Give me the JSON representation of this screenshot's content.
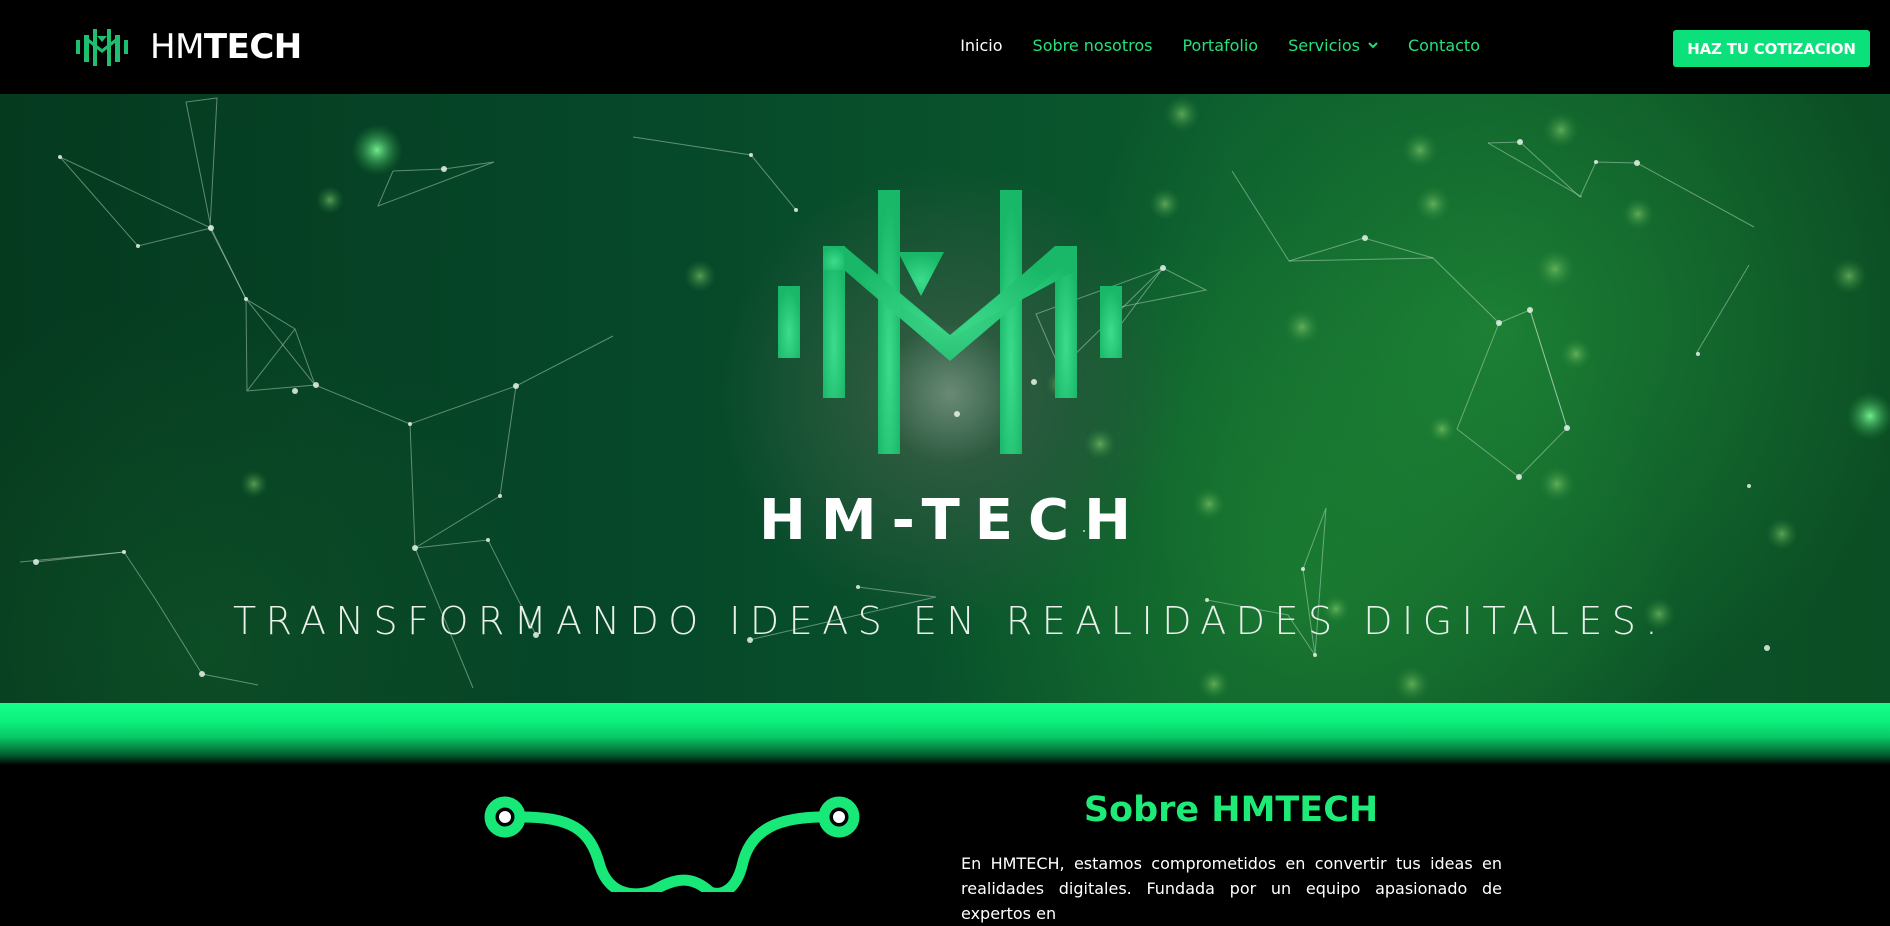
{
  "colors": {
    "accent": "#0be07a",
    "nav_link": "#27e07a",
    "nav_active": "#ffffff",
    "background": "#000000",
    "hero_green": "#0b5a2d",
    "logo_green": "#1ebf6e"
  },
  "header": {
    "brand": {
      "light": "HM",
      "bold": "TECH",
      "icon": "hm-logo-icon"
    },
    "nav": [
      {
        "label": "Inicio",
        "active": true
      },
      {
        "label": "Sobre nosotros",
        "active": false
      },
      {
        "label": "Portafolio",
        "active": false
      },
      {
        "label": "Servicios",
        "active": false,
        "icon": "chevron-down-icon"
      },
      {
        "label": "Contacto",
        "active": false
      }
    ],
    "cta_label": "HAZ TU COTIZACION"
  },
  "hero": {
    "logo_icon": "hm-logo-icon",
    "title": "HM-TECH",
    "tagline": "TRANSFORMANDO IDEAS EN REALIDADES DIGITALES."
  },
  "about": {
    "graphic_icon": "circuit-line-icon",
    "title": "Sobre HMTECH",
    "text": "En HMTECH, estamos comprometidos en convertir tus ideas en realidades digitales. Fundada por un equipo apasionado de expertos en"
  }
}
